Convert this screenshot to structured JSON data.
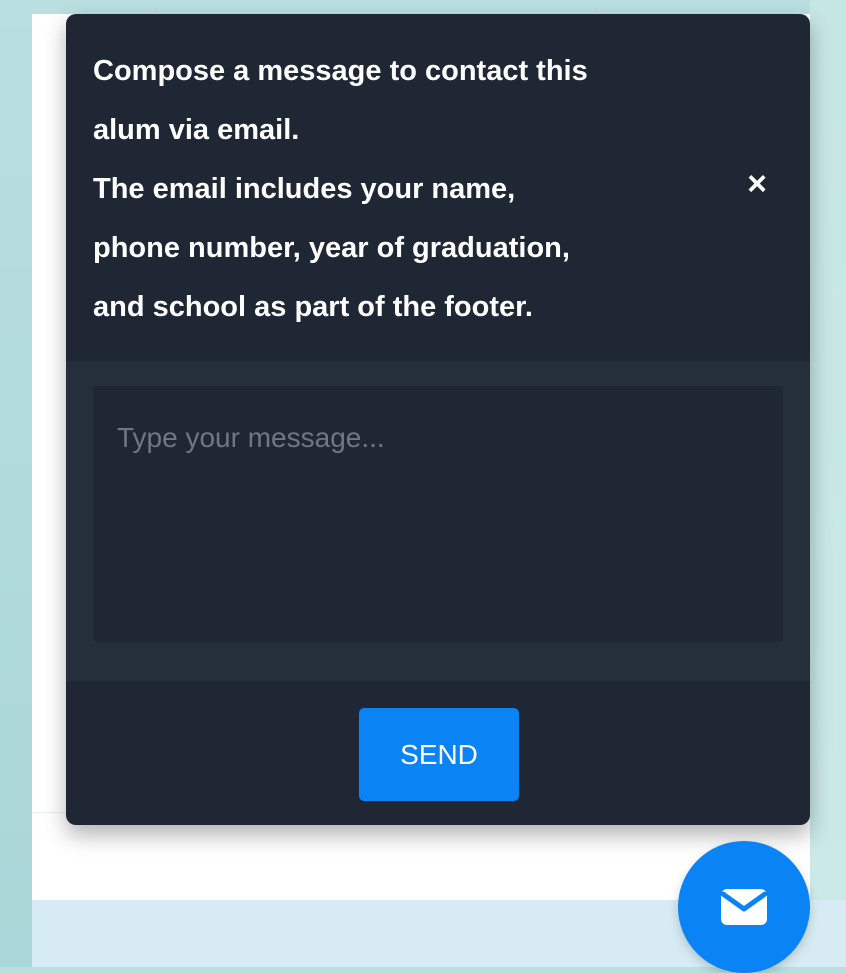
{
  "popup": {
    "message_lines": [
      "Compose a message to contact this",
      "alum via email.",
      "The email includes your name,",
      "phone number, year of graduation,",
      "and school as part of the footer."
    ],
    "close_symbol": "×",
    "input_placeholder": "Type your message...",
    "input_value": "",
    "send_label": "SEND"
  },
  "fab": {
    "icon": "envelope-icon"
  },
  "colors": {
    "popup_bg": "#1e2733",
    "popup_body_bg": "#252f3c",
    "accent": "#0a83f5",
    "text": "#ffffff",
    "placeholder": "#6f7780"
  }
}
